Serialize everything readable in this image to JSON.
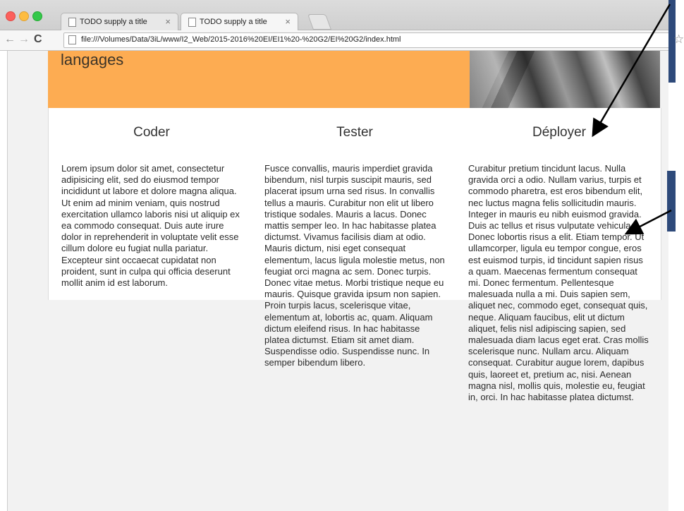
{
  "browser": {
    "tabs": [
      {
        "title": "TODO supply a title",
        "close": "×"
      },
      {
        "title": "TODO supply a title",
        "close": "×"
      }
    ],
    "url": "file:///Volumes/Data/3iL/www/I2_Web/2015-2016%20EI/EI1%20-%20G2/EI%20G2/index.html",
    "nav": {
      "back": "←",
      "forward": "→",
      "reload": "C"
    },
    "star": "☆"
  },
  "page": {
    "hero_title": "langages",
    "columns": [
      {
        "heading": "Coder",
        "text": "Lorem ipsum dolor sit amet, consectetur adipisicing elit, sed do eiusmod tempor incididunt ut labore et dolore magna aliqua. Ut enim ad minim veniam, quis nostrud exercitation ullamco laboris nisi ut aliquip ex ea commodo consequat. Duis aute irure dolor in reprehenderit in voluptate velit esse cillum dolore eu fugiat nulla pariatur. Excepteur sint occaecat cupidatat non proident, sunt in culpa qui officia deserunt mollit anim id est laborum."
      },
      {
        "heading": "Tester",
        "text": "Fusce convallis, mauris imperdiet gravida bibendum, nisl turpis suscipit mauris, sed placerat ipsum urna sed risus. In convallis tellus a mauris. Curabitur non elit ut libero tristique sodales. Mauris a lacus. Donec mattis semper leo. In hac habitasse platea dictumst. Vivamus facilisis diam at odio. Mauris dictum, nisi eget consequat elementum, lacus ligula molestie metus, non feugiat orci magna ac sem. Donec turpis. Donec vitae metus. Morbi tristique neque eu mauris. Quisque gravida ipsum non sapien. Proin turpis lacus, scelerisque vitae, elementum at, lobortis ac, quam. Aliquam dictum eleifend risus. In hac habitasse platea dictumst. Etiam sit amet diam. Suspendisse odio. Suspendisse nunc. In semper bibendum libero."
      },
      {
        "heading": "Déployer",
        "text": "Curabitur pretium tincidunt lacus. Nulla gravida orci a odio. Nullam varius, turpis et commodo pharetra, est eros bibendum elit, nec luctus magna felis sollicitudin mauris. Integer in mauris eu nibh euismod gravida. Duis ac tellus et risus vulputate vehicula. Donec lobortis risus a elit. Etiam tempor. Ut ullamcorper, ligula eu tempor congue, eros est euismod turpis, id tincidunt sapien risus a quam. Maecenas fermentum consequat mi. Donec fermentum. Pellentesque malesuada nulla a mi. Duis sapien sem, aliquet nec, commodo eget, consequat quis, neque. Aliquam faucibus, elit ut dictum aliquet, felis nisl adipiscing sapien, sed malesuada diam lacus eget erat. Cras mollis scelerisque nunc. Nullam arcu. Aliquam consequat. Curabitur augue lorem, dapibus quis, laoreet et, pretium ac, nisi. Aenean magna nisl, mollis quis, molestie eu, feugiat in, orci. In hac habitasse platea dictumst."
      }
    ]
  },
  "colors": {
    "hero_background": "#fdac52",
    "page_background": "#f2f2f2",
    "annotation_blue": "#2e4a7a"
  }
}
